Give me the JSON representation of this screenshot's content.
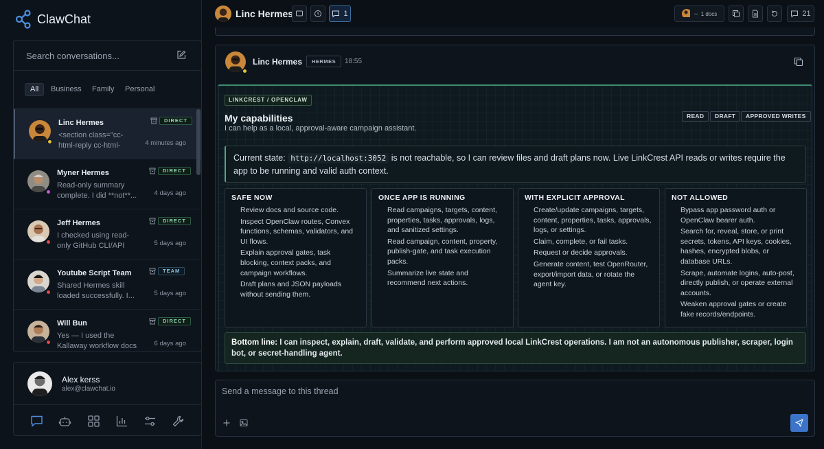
{
  "app": {
    "name": "ClawChat"
  },
  "search": {
    "placeholder": "Search conversations..."
  },
  "filters": [
    "All",
    "Business",
    "Family",
    "Personal"
  ],
  "conversations": [
    {
      "name": "Linc Hermes",
      "preview": "<section class=\"cc-html-reply cc-html-variant-...",
      "time": "4 minutes ago",
      "badge": "DIRECT",
      "status_color": "#e3c23a"
    },
    {
      "name": "Myner Hermes",
      "preview": "Read-only summary complete. I did **not**...",
      "time": "4 days ago",
      "badge": "DIRECT",
      "status_color": "#c25bd6"
    },
    {
      "name": "Jeff Hermes",
      "preview": "I checked using read-only GitHub CLI/API calls onl...",
      "time": "5 days ago",
      "badge": "DIRECT",
      "status_color": "#e04848"
    },
    {
      "name": "Youtube Script Team",
      "preview": "Shared Hermes skill loaded successfully. I...",
      "time": "5 days ago",
      "badge": "TEAM",
      "status_color": "#e04848"
    },
    {
      "name": "Will Bun",
      "preview": "Yes — I used the Kallaway workflow docs in: -...",
      "time": "6 days ago",
      "badge": "DIRECT",
      "status_color": "#e04848"
    }
  ],
  "user": {
    "name": "Alex kerss",
    "email": "alex@clawchat.io"
  },
  "dock_icons": [
    "chat-icon",
    "bot-icon",
    "grid-icon",
    "chart-icon",
    "sliders-icon",
    "wrench-icon"
  ],
  "thread": {
    "title": "Linc Hermes",
    "threads_count": "1",
    "docs_label": "1 docs",
    "docs_prefix": "--",
    "messages_count": "21"
  },
  "message": {
    "author": "Linc Hermes",
    "tag": "HERMES",
    "time": "18:55",
    "eyebrow": "LINKCREST / OPENCLAW",
    "title": "My capabilities",
    "subtitle": "I can help as a local, approval-aware campaign assistant.",
    "permissions": [
      "READ",
      "DRAFT",
      "APPROVED WRITES"
    ],
    "state_prefix": "Current state:",
    "state_url": "http://localhost:3052",
    "state_rest": "is not reachable, so I can review files and draft plans now. Live LinkCrest API reads or writes require the app to be running and valid auth context.",
    "columns": [
      {
        "title": "SAFE NOW",
        "items": [
          "Review docs and source code.",
          "Inspect OpenClaw routes, Convex functions, schemas, validators, and UI flows.",
          "Explain approval gates, task blocking, context packs, and campaign workflows.",
          "Draft plans and JSON payloads without sending them."
        ]
      },
      {
        "title": "ONCE APP IS RUNNING",
        "items": [
          "Read campaigns, targets, content, properties, tasks, approvals, logs, and sanitized settings.",
          "Read campaign, content, property, publish-gate, and task execution packs.",
          "Summarize live state and recommend next actions."
        ]
      },
      {
        "title": "WITH EXPLICIT APPROVAL",
        "items": [
          "Create/update campaigns, targets, content, properties, tasks, approvals, logs, or settings.",
          "Claim, complete, or fail tasks.",
          "Request or decide approvals.",
          "Generate content, test OpenRouter, export/import data, or rotate the agent key."
        ]
      },
      {
        "title": "NOT ALLOWED",
        "items": [
          "Bypass app password auth or OpenClaw bearer auth.",
          "Search for, reveal, store, or print secrets, tokens, API keys, cookies, hashes, encrypted blobs, or database URLs.",
          "Scrape, automate logins, auto-post, directly publish, or operate external accounts.",
          "Weaken approval gates or create fake records/endpoints."
        ]
      }
    ],
    "bottom_lead": "Bottom line:",
    "bottom_text": "I can inspect, explain, draft, validate, and perform approved local LinkCrest operations. I am not an autonomous publisher, scraper, login bot, or secret-handling agent."
  },
  "composer": {
    "placeholder": "Send a message to this thread"
  },
  "colors": {
    "accent": "#3b74c9",
    "success": "#4fa883",
    "background": "#0b1017"
  }
}
